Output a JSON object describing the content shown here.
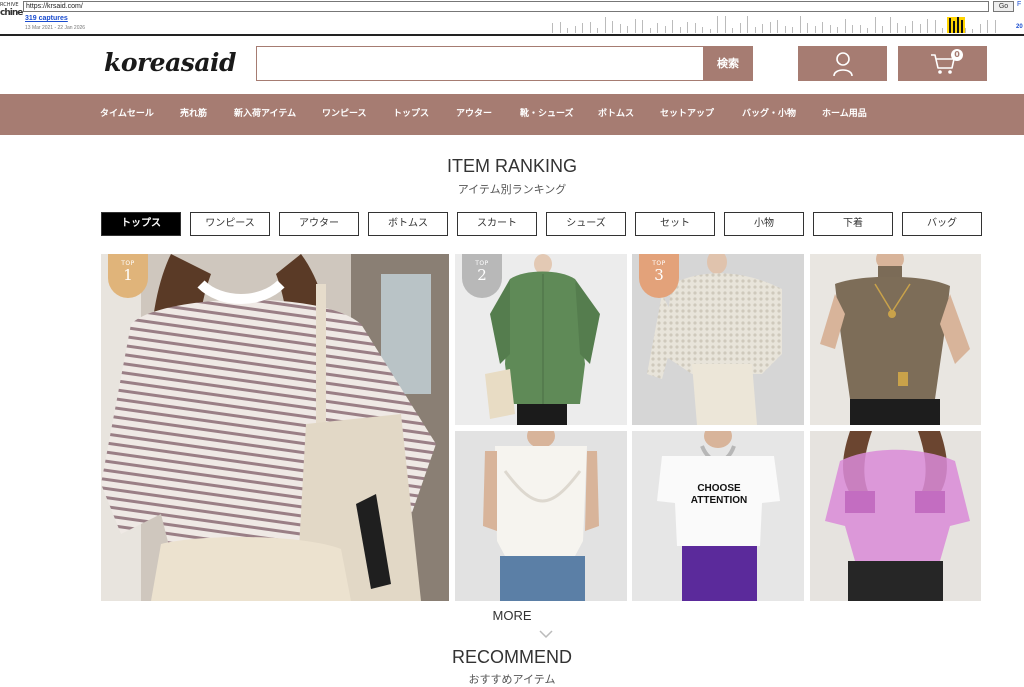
{
  "wayback": {
    "logo_small": "RCHIVE",
    "logo_big": "chine",
    "url": "https://krsaid.com/",
    "go_label": "Go",
    "f_label": "F",
    "captures": "319 captures",
    "dates": "13 Mar 2021 - 22 Jan 2026",
    "year": "20"
  },
  "header": {
    "logo": "koreasaid",
    "search_value": "",
    "search_button": "検索",
    "cart_count": "0"
  },
  "nav": [
    "タイムセール",
    "売れ筋",
    "新入荷アイテム",
    "ワンピース",
    "トップス",
    "アウター",
    "靴・シューズ",
    "ボトムス",
    "セットアップ",
    "バッグ・小物",
    "ホーム用品"
  ],
  "ranking": {
    "title": "ITEM RANKING",
    "subtitle": "アイテム別ランキング",
    "tabs": [
      "トップス",
      "ワンピース",
      "アウター",
      "ボトムス",
      "スカート",
      "シューズ",
      "セット",
      "小物",
      "下着",
      "バッグ"
    ],
    "active_tab": "トップス",
    "badge_label": "TOP",
    "ranks": [
      "1",
      "2",
      "3"
    ],
    "tshirt_print": "CHOOSE ATTENTION",
    "badge_colors": {
      "gold": "#e0b47a",
      "silver": "#b8b8b8",
      "bronze": "#e3a27a"
    }
  },
  "more_label": "MORE",
  "recommend": {
    "title": "RECOMMEND",
    "subtitle": "おすすめアイテム"
  },
  "colors": {
    "accent": "#a67c72"
  }
}
